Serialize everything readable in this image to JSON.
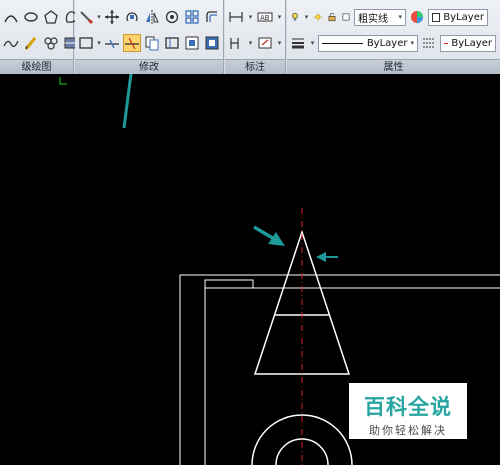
{
  "ribbon": {
    "panels": {
      "draw_advanced": {
        "title": "级绘图"
      },
      "modify": {
        "title": "修改"
      },
      "annotate": {
        "title": "标注"
      },
      "properties": {
        "title": "属性"
      }
    },
    "properties": {
      "layer_combo": "粗实线",
      "color_combo": "ByLayer",
      "linetype_combo": "ByLayer",
      "lineweight_combo": "ByLayer"
    }
  },
  "watermark": {
    "title": "百科全说",
    "subtitle": "助你轻松解决"
  },
  "colors": {
    "ribbon_bg": "#dde2e9",
    "panel_title_bg": "#b3bcc8",
    "canvas_bg": "#000000",
    "drawing_lines": "#ffffff",
    "centerline": "#d62020",
    "annotation_arrow": "#1f9a9a",
    "active_tool": "#ffd36b",
    "brand_teal": "#27a5a1"
  },
  "icons": {
    "draw_row1": [
      "arc-icon",
      "ellipse-icon",
      "polygon-icon",
      "blob-icon"
    ],
    "draw_row2": [
      "spline-icon",
      "pencil-icon",
      "revcloud-icon",
      "hatch-icon"
    ],
    "modify_row1": [
      "brush-icon",
      "move-icon",
      "rotate-icon",
      "mirror-icon",
      "fillet-icon",
      "array-icon",
      "stretch-icon"
    ],
    "modify_row2": [
      "rectangle-select-icon",
      "trim-icon",
      "extend-icon",
      "copy-icon",
      "offset-icon",
      "erase-icon",
      "explode-icon"
    ],
    "annotate": [
      "linear-dimension-icon",
      "text-icon",
      "leader-icon",
      "table-icon"
    ],
    "properties": [
      "bulb-icon",
      "sun-icon",
      "lock-icon",
      "layer-color-icon",
      "color-wheel-icon",
      "lineweight-icon"
    ]
  }
}
